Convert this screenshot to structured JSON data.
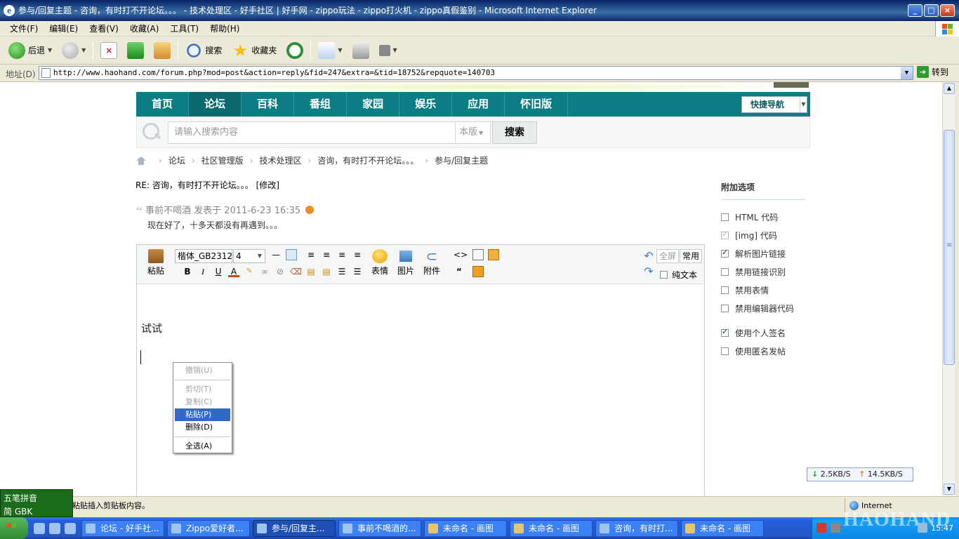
{
  "window": {
    "title": "参与/回复主题 - 咨询，有时打不开论坛。。。 - 技术处理区 - 好手社区 | 好手网 - zippo玩法 - zippo打火机 - zippo真假鉴别 - Microsoft Internet Explorer"
  },
  "menu": [
    "文件(F)",
    "编辑(E)",
    "查看(V)",
    "收藏(A)",
    "工具(T)",
    "帮助(H)"
  ],
  "toolbar": {
    "back": "后退",
    "search": "搜索",
    "favorites": "收藏夹"
  },
  "address": {
    "label": "地址(D)",
    "url": "http://www.haohand.com/forum.php?mod=post&action=reply&fid=247&extra=&tid=18752&repquote=140703",
    "go": "转到"
  },
  "site": {
    "nav": [
      "首页",
      "论坛",
      "百科",
      "番组",
      "家园",
      "娱乐",
      "应用",
      "怀旧版"
    ],
    "quick_nav": "快捷导航",
    "search": {
      "placeholder": "请输入搜索内容",
      "scope": "本版",
      "button": "搜索"
    },
    "breadcrumb": [
      "论坛",
      "社区管理版",
      "技术处理区",
      "咨询，有时打不开论坛。。。",
      "参与/回复主题"
    ]
  },
  "post": {
    "title": "RE: 咨询，有时打不开论坛。。。 [修改]",
    "quote_author": "事前不喝酒 发表于 2011-6-23 16:35",
    "quote_text": "现在好了，十多天都没有再遇到。。。"
  },
  "editor": {
    "paste": "粘贴",
    "font": "楷体_GB2312",
    "size": "4",
    "emoji": "表情",
    "image": "图片",
    "attach": "附件",
    "fullscreen": "全屏",
    "common": "常用",
    "plaintext": "纯文本",
    "content": "试试"
  },
  "context_menu": {
    "undo": "撤销(U)",
    "cut": "剪切(T)",
    "copy": "复制(C)",
    "paste": "粘贴(P)",
    "delete": "删除(D)",
    "select_all": "全选(A)"
  },
  "options": {
    "heading": "附加选项",
    "items": [
      {
        "label": "HTML 代码",
        "checked": false
      },
      {
        "label": "[img] 代码",
        "checked": true
      },
      {
        "label": "解析图片链接",
        "checked": true
      },
      {
        "label": "禁用链接识别",
        "checked": false
      },
      {
        "label": "禁用表情",
        "checked": false
      },
      {
        "label": "禁用编辑器代码",
        "checked": false
      },
      {
        "label": "使用个人签名",
        "checked": true
      },
      {
        "label": "使用匿名发帖",
        "checked": false
      }
    ]
  },
  "speed": {
    "down": "2.5KB/S",
    "up": "14.5KB/S"
  },
  "status": {
    "message": "粘贴插入剪贴板内容。",
    "zone": "Internet"
  },
  "ime": {
    "name": "五笔拼音",
    "mode": "简 GBK"
  },
  "taskbar": {
    "tasks": [
      "论坛 - 好手社...",
      "Zippo爱好者...",
      "参与/回复主...",
      "事前不喝酒的...",
      "未命名 - 画图",
      "未命名 - 画图",
      "咨询，有时打...",
      "未命名 - 画图"
    ],
    "clock": "15:47",
    "watermark": "HAOHAND"
  }
}
